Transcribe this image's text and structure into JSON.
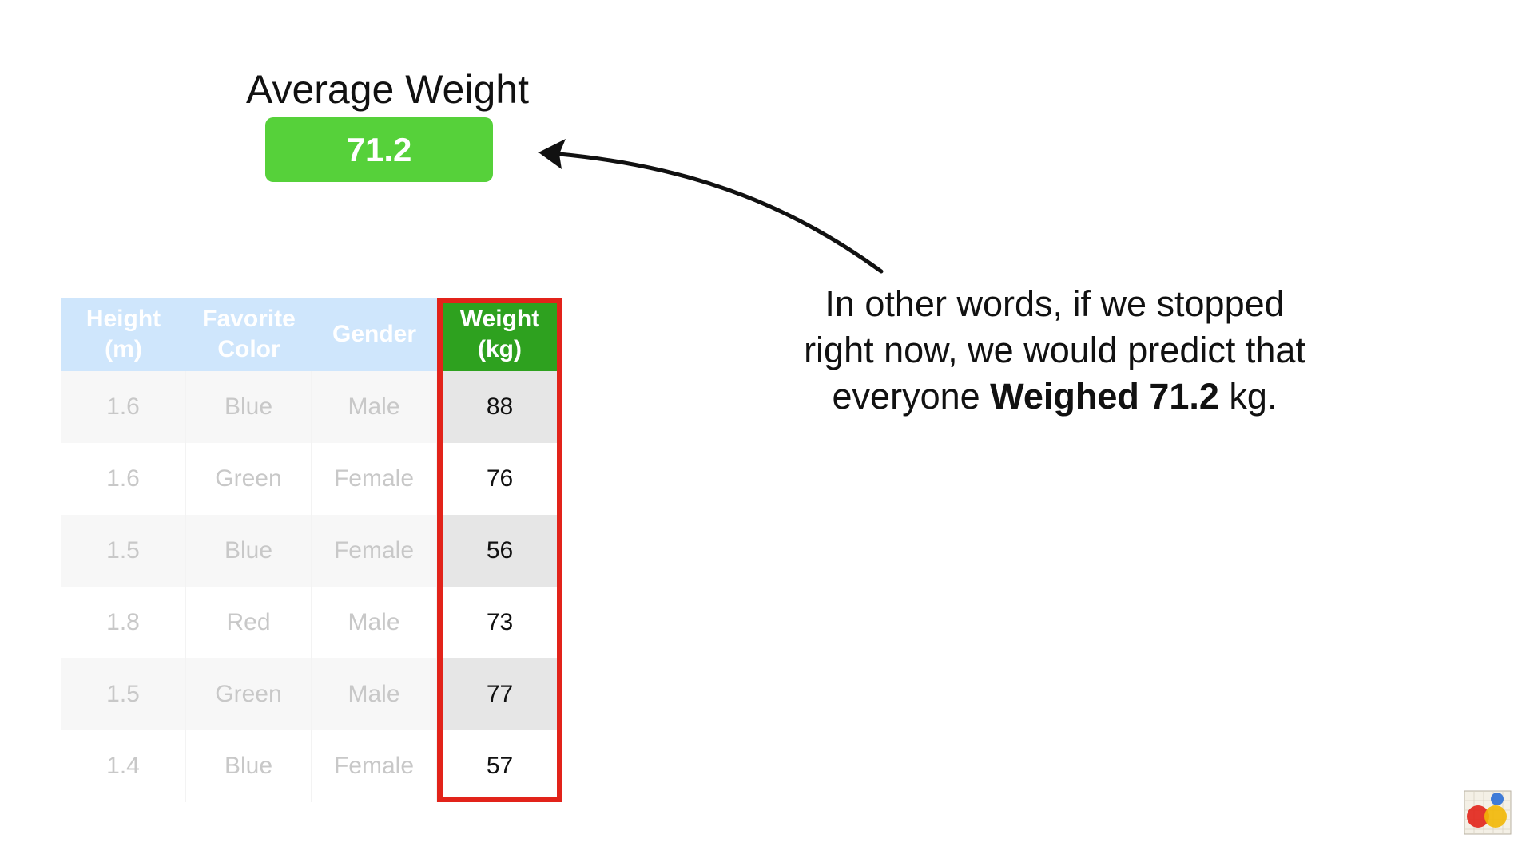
{
  "average": {
    "title": "Average Weight",
    "value": "71.2",
    "box_color": "#56d13a"
  },
  "explanation": {
    "line1": "In other words, if we stopped",
    "line2": "right now, we would predict that",
    "line3_pre": "everyone ",
    "line3_bold": "Weighed 71.2",
    "line3_post": " kg."
  },
  "table": {
    "headers": [
      "Height\n(m)",
      "Favorite\nColor",
      "Gender",
      "Weight\n(kg)"
    ],
    "rows": [
      [
        "1.6",
        "Blue",
        "Male",
        "88"
      ],
      [
        "1.6",
        "Green",
        "Female",
        "76"
      ],
      [
        "1.5",
        "Blue",
        "Female",
        "56"
      ],
      [
        "1.8",
        "Red",
        "Male",
        "73"
      ],
      [
        "1.5",
        "Green",
        "Male",
        "77"
      ],
      [
        "1.4",
        "Blue",
        "Female",
        "57"
      ]
    ],
    "header_color": "#cfe6fc",
    "weight_header_color": "#2ea11f",
    "highlight_color": "#e2231a"
  },
  "icons": {
    "arrow": "curved-arrow-icon",
    "logo": "statquest-logo-icon"
  }
}
